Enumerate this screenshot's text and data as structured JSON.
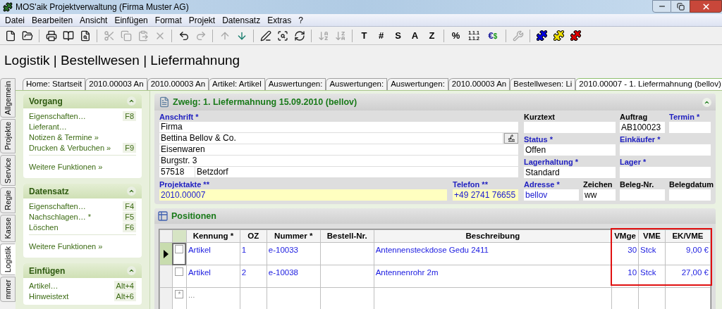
{
  "window": {
    "title": "MOS'aik Projektverwaltung (Firma Muster AG)"
  },
  "menu": [
    "Datei",
    "Bearbeiten",
    "Ansicht",
    "Einfügen",
    "Format",
    "Projekt",
    "Datensatz",
    "Extras",
    "?"
  ],
  "toolbar": [
    {
      "kind": "icon",
      "disabled": false
    },
    {
      "kind": "icon",
      "disabled": false
    },
    {
      "kind": "separator"
    },
    {
      "kind": "icon",
      "disabled": false
    },
    {
      "kind": "icon",
      "disabled": false
    },
    {
      "kind": "icon",
      "disabled": false
    },
    {
      "kind": "separator"
    },
    {
      "kind": "icon",
      "disabled": true
    },
    {
      "kind": "icon",
      "disabled": true
    },
    {
      "kind": "icon",
      "disabled": true
    },
    {
      "kind": "icon",
      "disabled": true
    },
    {
      "kind": "separator"
    },
    {
      "kind": "icon",
      "disabled": false
    },
    {
      "kind": "icon",
      "disabled": true
    },
    {
      "kind": "separator"
    },
    {
      "kind": "icon",
      "disabled": true
    },
    {
      "kind": "icon",
      "disabled": false
    },
    {
      "kind": "separator"
    },
    {
      "kind": "icon",
      "disabled": false
    },
    {
      "kind": "icon",
      "disabled": false
    },
    {
      "kind": "icon",
      "disabled": false
    },
    {
      "kind": "separator"
    },
    {
      "kind": "icon",
      "disabled": true
    },
    {
      "kind": "icon",
      "disabled": true
    },
    {
      "kind": "separator"
    },
    {
      "kind": "text",
      "label": "T"
    },
    {
      "kind": "text",
      "label": "#"
    },
    {
      "kind": "text",
      "label": "S"
    },
    {
      "kind": "text",
      "label": "A"
    },
    {
      "kind": "text",
      "label": "Z"
    },
    {
      "kind": "separator"
    },
    {
      "kind": "text",
      "label": "%"
    },
    {
      "kind": "stack",
      "lines": [
        "1.1.1",
        "1.1.2"
      ]
    },
    {
      "kind": "pair",
      "parts": [
        "€",
        "$"
      ]
    },
    {
      "kind": "separator"
    },
    {
      "kind": "icon",
      "disabled": true
    },
    {
      "kind": "separator"
    },
    {
      "kind": "puzzle",
      "color": "#0000e0"
    },
    {
      "kind": "puzzle",
      "color": "#f0e000"
    },
    {
      "kind": "puzzle",
      "color": "#e00000"
    }
  ],
  "breadcrumb": "Logistik | Bestellwesen | Liefermahnung",
  "side_tabs": [
    {
      "label": "Allgemein",
      "selected": false
    },
    {
      "label": "Projekte",
      "selected": false
    },
    {
      "label": "Service",
      "selected": false
    },
    {
      "label": "Regie",
      "selected": false
    },
    {
      "label": "Kasse",
      "selected": false
    },
    {
      "label": "Logistik",
      "selected": true
    },
    {
      "label": "mmer",
      "selected": false
    }
  ],
  "doc_tabs": [
    {
      "label": "Home: Startseit",
      "selected": false
    },
    {
      "label": "2010.00003 An",
      "selected": false
    },
    {
      "label": "2010.00003 An",
      "selected": false
    },
    {
      "label": "Artikel: Artikel",
      "selected": false
    },
    {
      "label": "Auswertungen:",
      "selected": false
    },
    {
      "label": "Auswertungen:",
      "selected": false
    },
    {
      "label": "Auswertungen:",
      "selected": false
    },
    {
      "label": "2010.00003 An",
      "selected": false
    },
    {
      "label": "Bestellwesen: Li",
      "selected": false
    },
    {
      "label": "2010.00007 - 1. Liefermahnung (bellov)",
      "selected": true
    }
  ],
  "sidebar": [
    {
      "title": "Vorgang",
      "expanded": true,
      "items": [
        {
          "label": "Eigenschaften…",
          "shortcut": "F8"
        },
        {
          "label": "Lieferant…"
        },
        {
          "label": "Notizen & Termine »"
        },
        {
          "label": "Drucken & Verbuchen »",
          "shortcut": "F9"
        }
      ],
      "more": "Weitere Funktionen »"
    },
    {
      "title": "Datensatz",
      "expanded": true,
      "items": [
        {
          "label": "Eigenschaften…",
          "shortcut": "F4"
        },
        {
          "label": "Nachschlagen… *",
          "shortcut": "F5"
        },
        {
          "label": "Löschen",
          "shortcut": "F6"
        }
      ],
      "more": "Weitere Funktionen »"
    },
    {
      "title": "Einfügen",
      "expanded": true,
      "items": [
        {
          "label": "Artikel…",
          "shortcut": "Alt+4"
        },
        {
          "label": "Hinweistext",
          "shortcut": "Alt+6"
        }
      ]
    }
  ],
  "form": {
    "title": "Zweig: 1. Liefermahnung 15.09.2010 (bellov)",
    "expanded": true,
    "address": {
      "label": "Anschrift *",
      "required": true,
      "lines": [
        "Firma",
        "Bettina Bellov & Co.",
        "Eisenwaren",
        "Burgstr. 3"
      ],
      "zip": "57518",
      "city": "Betzdorf"
    },
    "left_fields": [
      {
        "label": "Projektakte **",
        "required": true,
        "value": "2010.00007",
        "highlighted": true,
        "linked": true
      },
      {
        "label": "Telefon **",
        "required": true,
        "value": "+49 2741 76655",
        "highlighted": true,
        "linked": true
      }
    ],
    "right_fields": [
      {
        "label": "Kurztext",
        "required": false
      },
      {
        "label": "Auftrag",
        "required": false,
        "value": "AB100023"
      },
      {
        "label": "Termin *",
        "required": true
      },
      {
        "label": "Status *",
        "required": true,
        "value": "Offen"
      },
      {
        "label": "Einkäufer *",
        "required": true
      },
      {
        "label": "Lagerhaltung *",
        "required": true,
        "value": "Standard"
      },
      {
        "label": "Lager *",
        "required": true
      },
      {
        "label": "Adresse *",
        "required": true,
        "value": "bellov",
        "linked": true
      },
      {
        "label": "Zeichen",
        "required": false,
        "value": "ww"
      },
      {
        "label": "Beleg-Nr.",
        "required": false
      },
      {
        "label": "Belegdatum",
        "required": false
      }
    ]
  },
  "positions": {
    "title": "Positionen",
    "columns": [
      {
        "label": "Kennung *",
        "highlighted": false
      },
      {
        "label": "OZ",
        "highlighted": false
      },
      {
        "label": "Nummer *",
        "highlighted": false
      },
      {
        "label": "Bestell-Nr.",
        "highlighted": false
      },
      {
        "label": "Beschreibung",
        "highlighted": false
      },
      {
        "label": "VMge",
        "highlighted": true
      },
      {
        "label": "VME",
        "highlighted": true
      },
      {
        "label": "EK/VME",
        "highlighted": true
      }
    ],
    "rows": [
      {
        "current": true,
        "checked": false,
        "cells": [
          "Artikel",
          "1",
          "e-10033",
          null,
          "Antennensteckdose Gedu 2411",
          "30",
          "Stck",
          "9,00 €"
        ]
      },
      {
        "current": false,
        "checked": false,
        "cells": [
          "Artikel",
          "2",
          "e-10038",
          null,
          "Antennenrohr 2m",
          "10",
          "Stck",
          "27,00 €"
        ]
      }
    ],
    "new_row": {
      "marker": "*",
      "placeholder": "..."
    }
  }
}
